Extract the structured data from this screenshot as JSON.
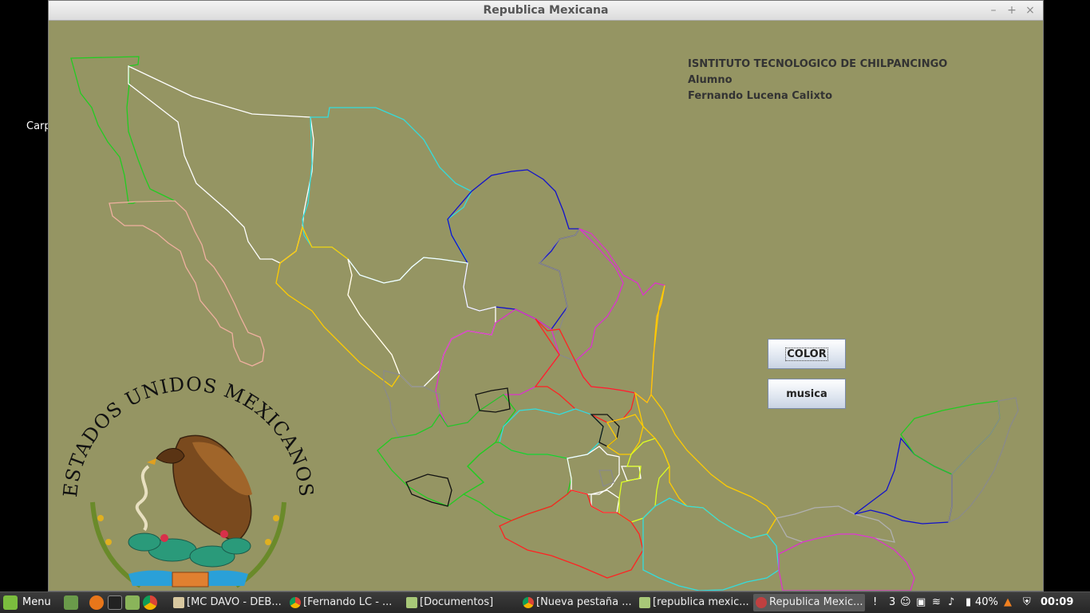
{
  "desktop": {
    "partial_icon_label": "Carp"
  },
  "window": {
    "title": "Republica Mexicana",
    "controls": {
      "minimize": "–",
      "maximize": "+",
      "close": "×"
    }
  },
  "info": {
    "line1": "ISNTITUTO TECNOLOGICO DE CHILPANCINGO",
    "line2": "Alumno",
    "line3": "Fernando Lucena Calixto"
  },
  "buttons": {
    "color": "COLOR",
    "music": "musica"
  },
  "seal": {
    "text": "ESTADOS UNIDOS MEXICANOS"
  },
  "taskbar": {
    "menu_label": "Menu",
    "tasks": [
      {
        "label": "[MC DAVO - DEB...",
        "icon": "media-icon"
      },
      {
        "label": "[Fernando LC - ...",
        "icon": "chrome-icon"
      },
      {
        "label": "[Documentos]",
        "icon": "folder-icon"
      },
      {
        "label": "[Nueva pestaña ...",
        "icon": "chrome-icon"
      },
      {
        "label": "[republica mexic...",
        "icon": "folder-icon"
      },
      {
        "label": "Republica Mexic...",
        "icon": "java-icon"
      }
    ],
    "tray": {
      "notifications": "3",
      "battery": "40%",
      "clock": "00:09"
    }
  },
  "colors": {
    "map_background": "#959563",
    "accent_blue": "#0000cc"
  }
}
